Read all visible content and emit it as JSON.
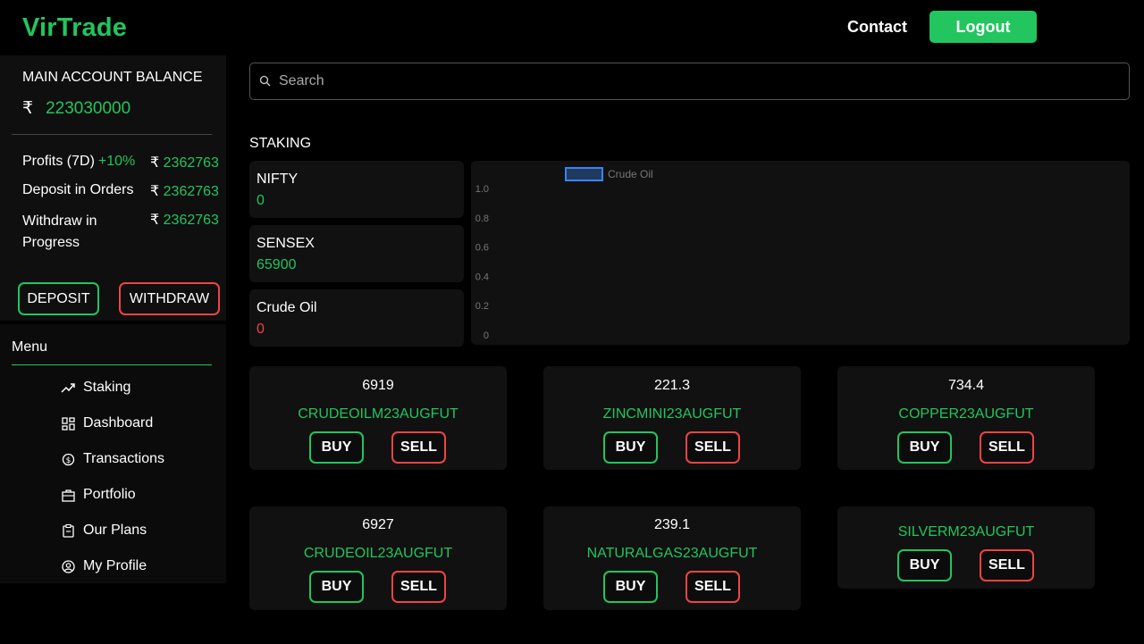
{
  "header": {
    "logo": "VirTrade",
    "contact": "Contact",
    "logout": "Logout"
  },
  "account": {
    "balance_label": "MAIN ACCOUNT BALANCE",
    "currency": "₹",
    "balance": "223030000",
    "profits_label": "Profits (7D)",
    "profits_pct": "+10%",
    "profits_value": "2362763",
    "deposit_label": "Deposit in Orders",
    "deposit_value": "2362763",
    "withdraw_label_1": "Withdraw in",
    "withdraw_label_2": "Progress",
    "withdraw_value": "2362763",
    "deposit_button": "DEPOSIT",
    "withdraw_button": "WITHDRAW"
  },
  "menu": {
    "title": "Menu",
    "items": [
      {
        "label": "Staking",
        "icon": "trending-up-icon"
      },
      {
        "label": "Dashboard",
        "icon": "dashboard-grid-icon"
      },
      {
        "label": "Transactions",
        "icon": "transactions-icon"
      },
      {
        "label": "Portfolio",
        "icon": "briefcase-icon"
      },
      {
        "label": "Our Plans",
        "icon": "clipboard-icon"
      },
      {
        "label": "My Profile",
        "icon": "user-circle-icon"
      }
    ]
  },
  "search": {
    "placeholder": "Search",
    "value": ""
  },
  "staking": {
    "title": "STAKING",
    "items": [
      {
        "name": "NIFTY",
        "value": "0",
        "color": "#22c55e"
      },
      {
        "name": "SENSEX",
        "value": "65900",
        "color": "#22c55e"
      },
      {
        "name": "Crude Oil",
        "value": "0",
        "color": "#ef4444"
      }
    ]
  },
  "chart_data": {
    "type": "bar",
    "categories": [],
    "series": [
      {
        "name": "Crude Oil",
        "values": []
      }
    ],
    "yticks": [
      "1.0",
      "0.8",
      "0.6",
      "0.4",
      "0.2",
      "0"
    ],
    "ylim": [
      0,
      1
    ],
    "legend": "top-left",
    "series_color": "#3b82f6"
  },
  "trades": [
    {
      "price": "6919",
      "symbol": "CRUDEOILM23AUGFUT",
      "buy": "BUY",
      "sell": "SELL"
    },
    {
      "price": "221.3",
      "symbol": "ZINCMINI23AUGFUT",
      "buy": "BUY",
      "sell": "SELL"
    },
    {
      "price": "734.4",
      "symbol": "COPPER23AUGFUT",
      "buy": "BUY",
      "sell": "SELL"
    },
    {
      "price": "6927",
      "symbol": "CRUDEOIL23AUGFUT",
      "buy": "BUY",
      "sell": "SELL"
    },
    {
      "price": "239.1",
      "symbol": "NATURALGAS23AUGFUT",
      "buy": "BUY",
      "sell": "SELL"
    },
    {
      "price": "",
      "symbol": "SILVERM23AUGFUT",
      "buy": "BUY",
      "sell": "SELL"
    }
  ]
}
